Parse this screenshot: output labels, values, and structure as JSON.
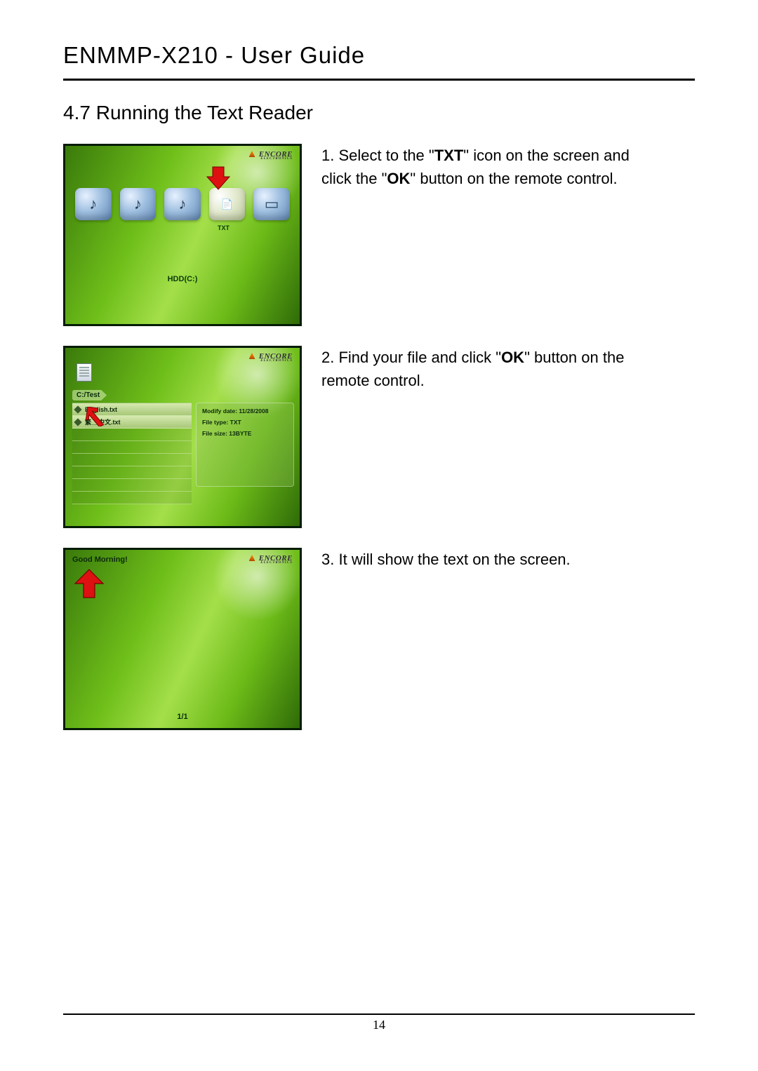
{
  "header": {
    "title": "ENMMP-X210  -  User  Guide"
  },
  "section": {
    "number": "4.7",
    "title": "Running the Text Reader"
  },
  "brand": {
    "name": "ENCORE",
    "sub": "ELECTRONICS"
  },
  "steps": [
    {
      "n": "1.",
      "pre": "Select to the \"",
      "bold1": "TXT",
      "mid": "\" icon on the screen and click the \"",
      "bold2": "OK",
      "post": "\" button on the remote control."
    },
    {
      "n": "2.",
      "pre": "Find your file and click \"",
      "bold1": "OK",
      "mid": "\" button on the remote control.",
      "bold2": "",
      "post": ""
    },
    {
      "n": "3.",
      "pre": "It will show the text on the screen.",
      "bold1": "",
      "mid": "",
      "bold2": "",
      "post": ""
    }
  ],
  "screenshot1": {
    "icons": [
      "music-icon",
      "music-icon",
      "music-icon",
      "txt-icon",
      "folder-icon"
    ],
    "txt_label": "TXT",
    "storage": "HDD(C:)"
  },
  "screenshot2": {
    "breadcrumb": "C:/Test",
    "files": [
      "English.txt",
      "繁__中文.txt"
    ],
    "info": {
      "modify": "Modify date: 11/28/2008",
      "type": "File type: TXT",
      "size": "File size: 13BYTE"
    }
  },
  "screenshot3": {
    "content": "Good Morning!",
    "page": "1/1"
  },
  "page_number": "14"
}
